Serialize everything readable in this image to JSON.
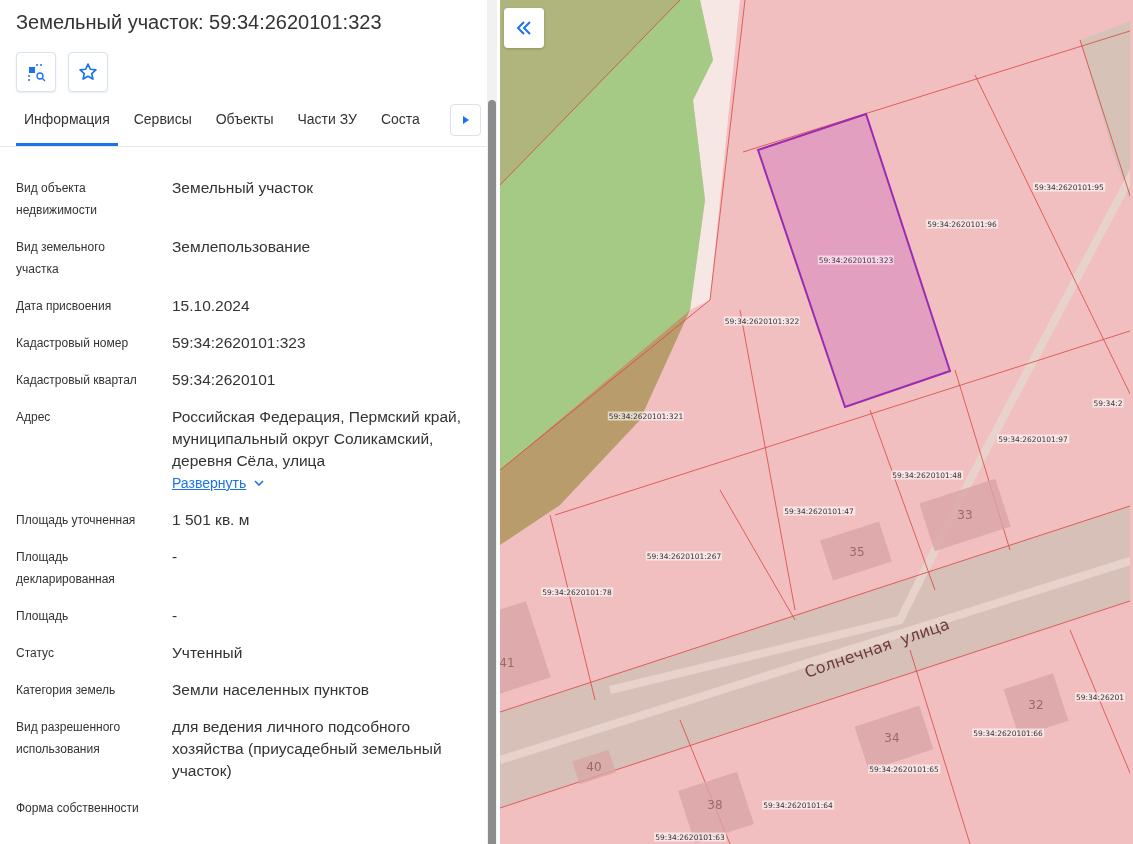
{
  "panel": {
    "title": "Земельный участок: 59:34:2620101:323",
    "tabs": [
      {
        "label": "Информация",
        "selected": true
      },
      {
        "label": "Сервисы",
        "selected": false
      },
      {
        "label": "Объекты",
        "selected": false
      },
      {
        "label": "Части ЗУ",
        "selected": false
      },
      {
        "label": "Соста",
        "selected": false
      }
    ],
    "fields": [
      {
        "label": "Вид объекта недвижимости",
        "value": "Земельный участок"
      },
      {
        "label": "Вид земельного участка",
        "value": "Землепользование"
      },
      {
        "label": "Дата присвоения",
        "value": "15.10.2024"
      },
      {
        "label": "Кадастровый номер",
        "value": "59:34:2620101:323"
      },
      {
        "label": "Кадастровый квартал",
        "value": "59:34:2620101"
      },
      {
        "label": "Адрес",
        "value": "Российская Федерация, Пермский край, муниципальный округ Соликамский, деревня Сёла, улица",
        "link": "Развернуть"
      },
      {
        "label": "Площадь уточненная",
        "value": "1 501 кв. м"
      },
      {
        "label": "Площадь декларированная",
        "value": "-"
      },
      {
        "label": "Площадь",
        "value": "-"
      },
      {
        "label": "Статус",
        "value": "Учтенный"
      },
      {
        "label": "Категория земель",
        "value": "Земли населенных пунктов"
      },
      {
        "label": "Вид разрешенного использования",
        "value": "для ведения личного подсобного хозяйства (приусадебный земельный участок)"
      },
      {
        "label": "Форма собственности"
      }
    ]
  },
  "map": {
    "plot_labels": [
      {
        "text": "59:34:2620101:323",
        "selected": true
      },
      {
        "text": "59:34:2620101:96",
        "selected": false
      },
      {
        "text": "59:34:2620101:95",
        "selected": false
      },
      {
        "text": "59:34:2620101:322",
        "selected": false
      },
      {
        "text": "59:34:2620101:321",
        "selected": false
      },
      {
        "text": "59:34:2620101:97",
        "selected": false
      },
      {
        "text": "59:34:2620101:48",
        "selected": false
      },
      {
        "text": "59:34:2620101:47",
        "selected": false
      },
      {
        "text": "59:34:2620101:267",
        "selected": false
      },
      {
        "text": "59:34:2620101:78",
        "selected": false
      },
      {
        "text": "59:34:2620101:66",
        "selected": false
      },
      {
        "text": "59:34:2620101:65",
        "selected": false
      },
      {
        "text": "59:34:2620101:64",
        "selected": false
      },
      {
        "text": "59:34:2620101:63",
        "selected": false
      },
      {
        "text": "59:34:2",
        "selected": false
      },
      {
        "text": "59:34:26201",
        "selected": false
      }
    ],
    "house_numbers": [
      "33",
      "35",
      "41",
      "34",
      "32",
      "40",
      "38"
    ],
    "street": "Солнечная  улица"
  }
}
